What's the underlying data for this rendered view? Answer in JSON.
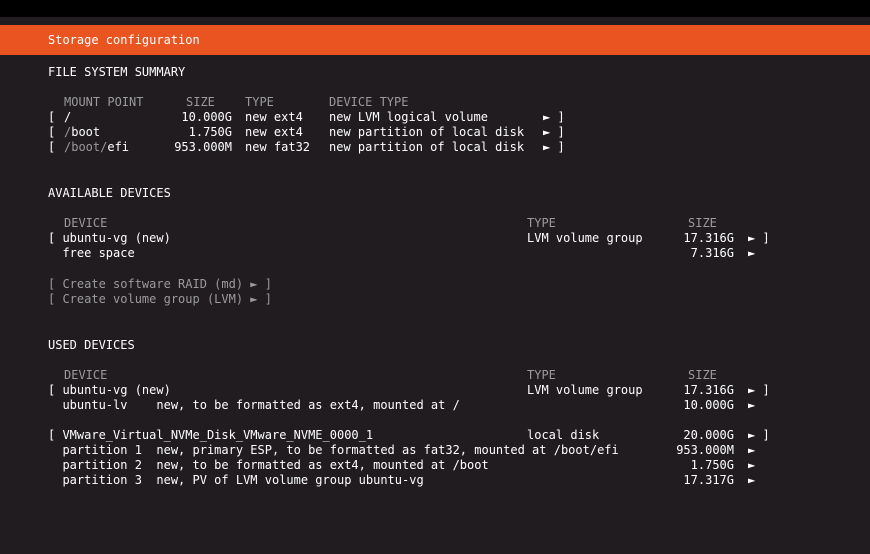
{
  "header": {
    "title": "Storage configuration"
  },
  "summary": {
    "heading": "FILE SYSTEM SUMMARY",
    "cols": {
      "mount": "MOUNT POINT",
      "size": "SIZE",
      "type": "TYPE",
      "devtype": "DEVICE TYPE"
    },
    "rows": [
      {
        "open": "[",
        "mount_dim": "",
        "mount": "/",
        "size": "10.000G",
        "type": "new ext4",
        "devtype": "new LVM logical volume",
        "arrow": "► ]"
      },
      {
        "open": "[",
        "mount_dim": "/",
        "mount": "boot",
        "size": "1.750G",
        "type": "new ext4",
        "devtype": "new partition of local disk",
        "arrow": "► ]"
      },
      {
        "open": "[",
        "mount_dim": "/boot/",
        "mount": "efi",
        "size": "953.000M",
        "type": "new fat32",
        "devtype": "new partition of local disk",
        "arrow": "► ]"
      }
    ]
  },
  "available": {
    "heading": "AVAILABLE DEVICES",
    "cols": {
      "device": "DEVICE",
      "type": "TYPE",
      "size": "SIZE"
    },
    "rows": [
      {
        "label": "[ ubuntu-vg (new)",
        "type": "LVM volume group",
        "size": "17.316G",
        "arrow": "► ]"
      },
      {
        "label": "  free space",
        "type": "",
        "size": "7.316G",
        "arrow": "►"
      }
    ],
    "actions": [
      "[ Create software RAID (md) ► ]",
      "[ Create volume group (LVM) ► ]"
    ]
  },
  "used": {
    "heading": "USED DEVICES",
    "cols": {
      "device": "DEVICE",
      "type": "TYPE",
      "size": "SIZE"
    },
    "groups": [
      [
        {
          "label": "[ ubuntu-vg (new)",
          "type": "LVM volume group",
          "size": "17.316G",
          "arrow": "► ]"
        },
        {
          "label": "  ubuntu-lv    new, to be formatted as ext4, mounted at /",
          "type": "",
          "size": "10.000G",
          "arrow": "►"
        }
      ],
      [
        {
          "label": "[ VMware_Virtual_NVMe_Disk_VMware_NVME_0000_1",
          "type": "local disk",
          "size": "20.000G",
          "arrow": "► ]"
        },
        {
          "label": "  partition 1  new, primary ESP, to be formatted as fat32, mounted at /boot/efi",
          "type": "",
          "size": "953.000M",
          "arrow": "►"
        },
        {
          "label": "  partition 2  new, to be formatted as ext4, mounted at /boot",
          "type": "",
          "size": "1.750G",
          "arrow": "►"
        },
        {
          "label": "  partition 3  new, PV of LVM volume group ubuntu-vg",
          "type": "",
          "size": "17.317G",
          "arrow": "►"
        }
      ]
    ]
  }
}
